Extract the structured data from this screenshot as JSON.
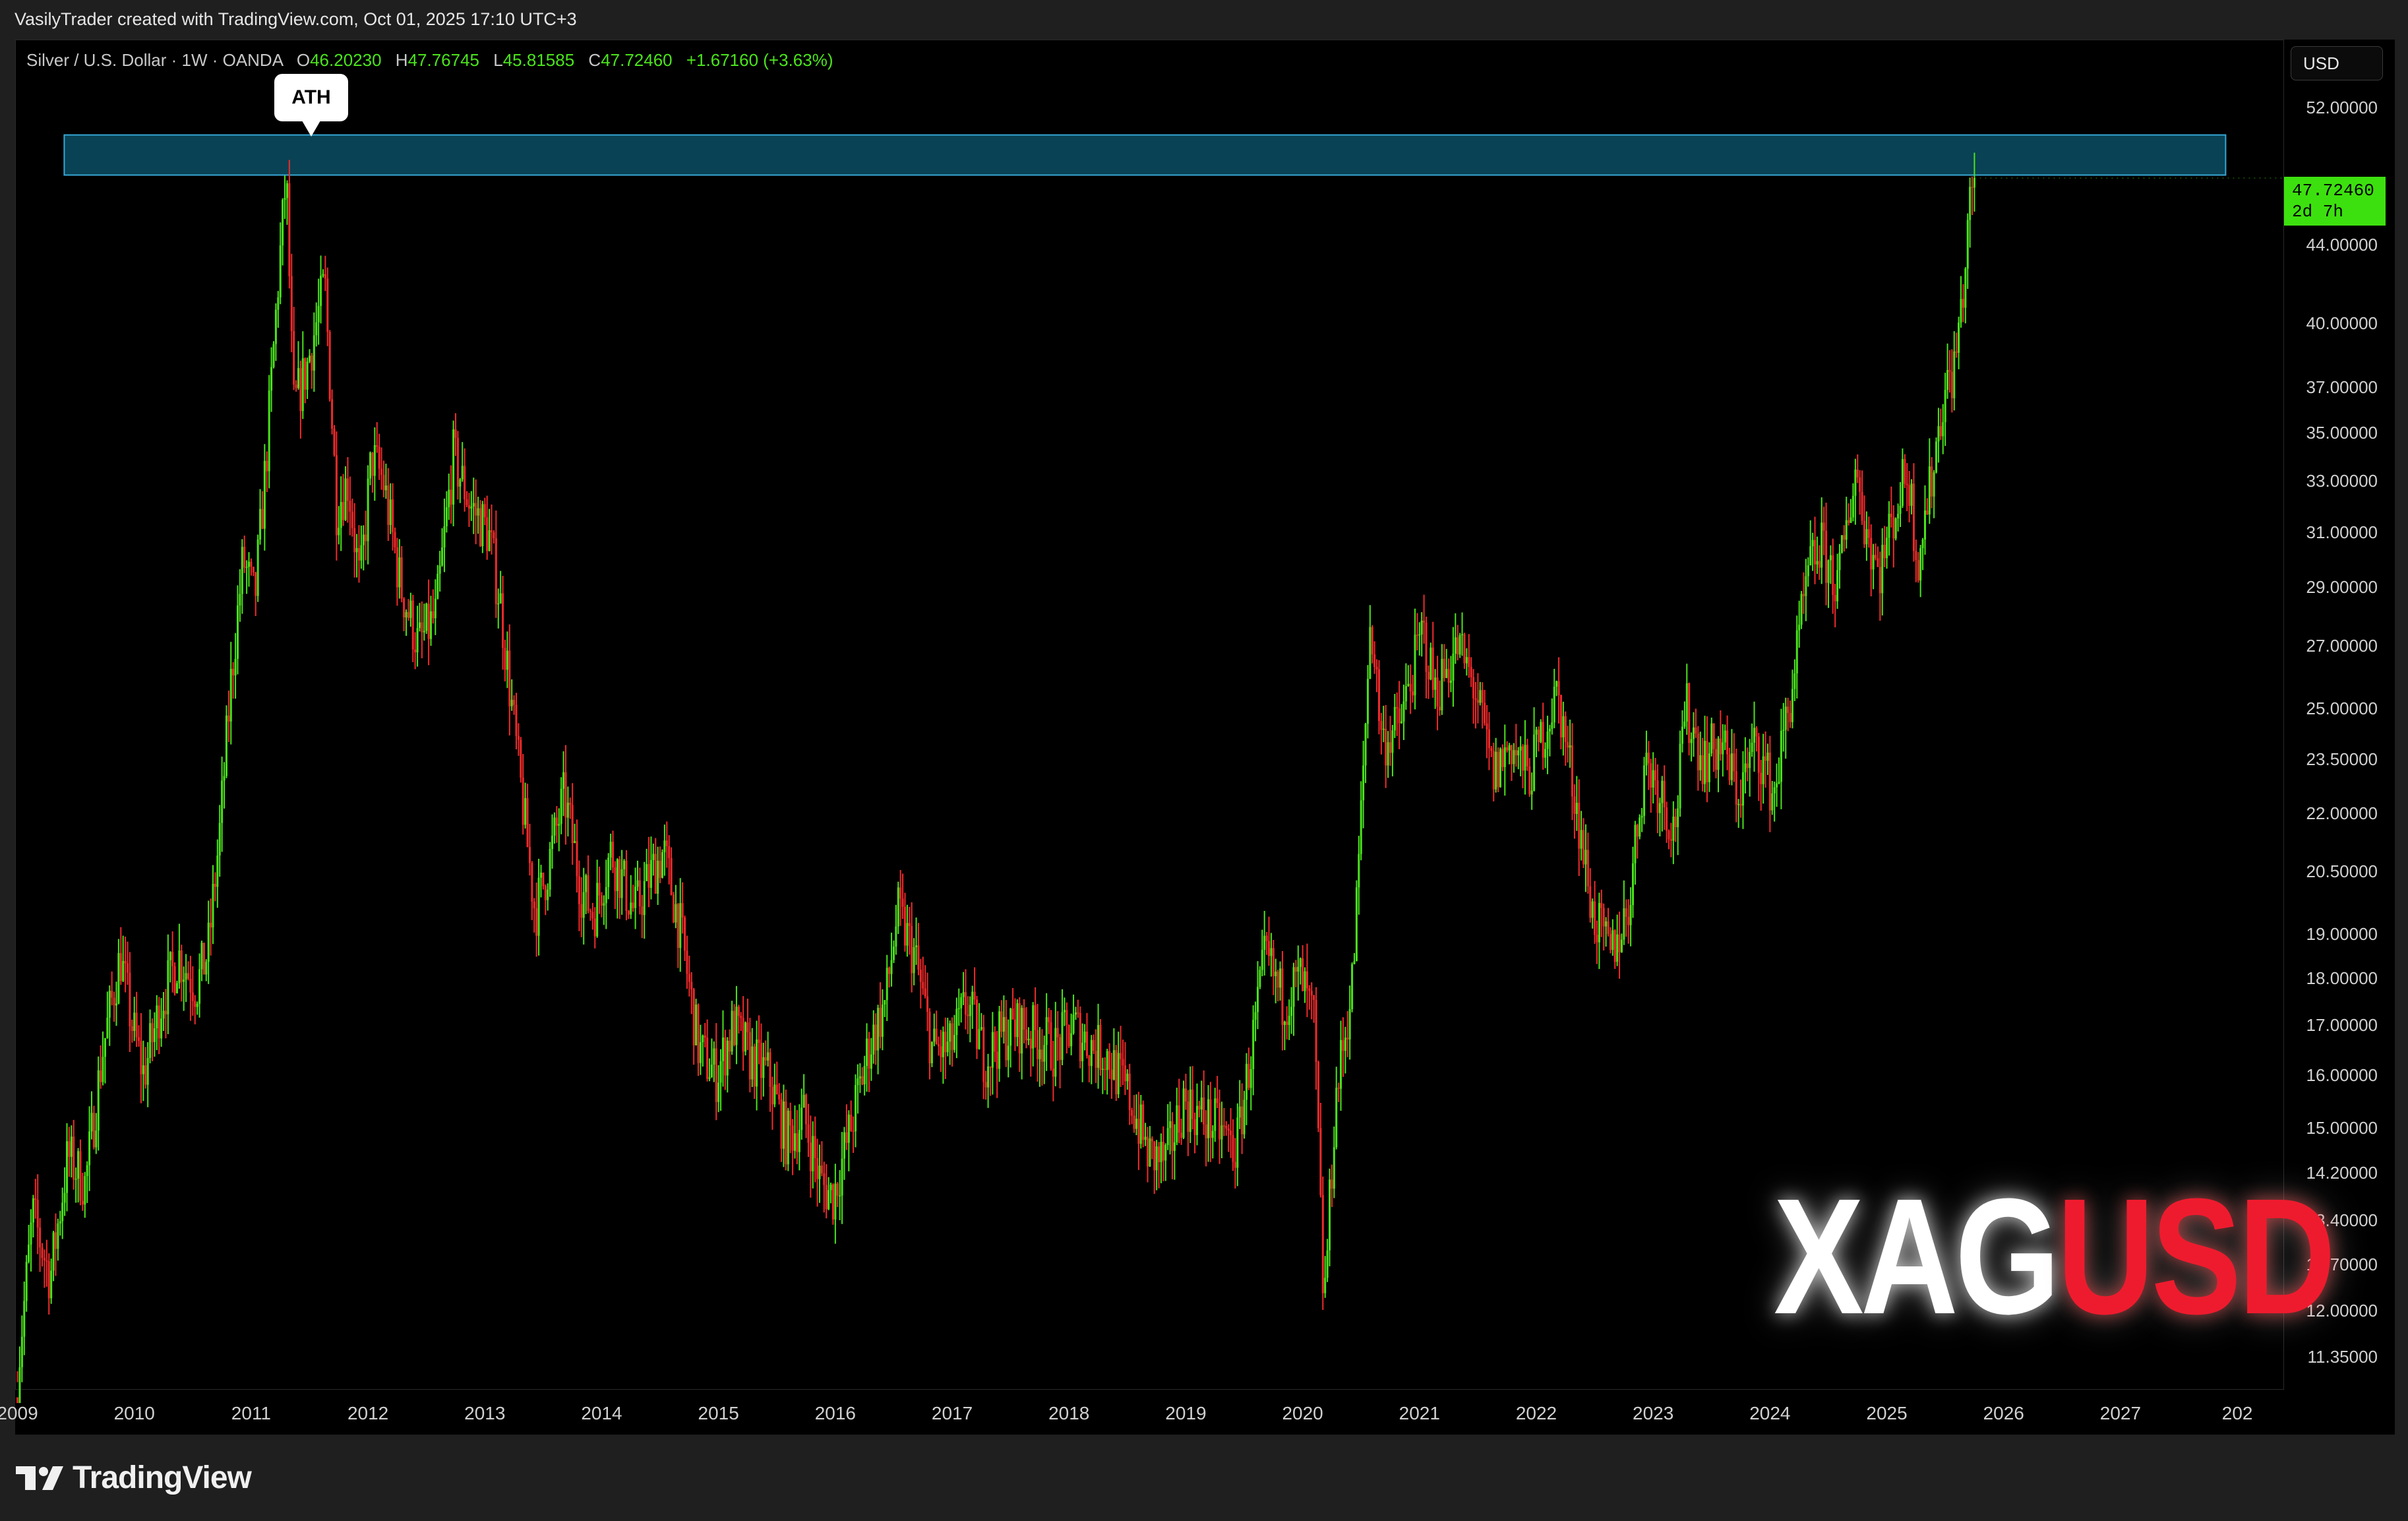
{
  "header": {
    "credit": "VasilyTrader created with TradingView.com, Oct 01, 2025 17:10 UTC+3"
  },
  "legend": {
    "symbol": "Silver / U.S. Dollar · 1W · OANDA",
    "open_label": "O",
    "open": "46.20230",
    "high_label": "H",
    "high": "47.76745",
    "low_label": "L",
    "low": "45.81585",
    "close_label": "C",
    "close": "47.72460",
    "change": "+1.67160 (+3.63%)"
  },
  "currency_button": "USD",
  "price_tag": {
    "price": "47.72460",
    "countdown": "2d 7h"
  },
  "annotation": {
    "label": "ATH"
  },
  "watermark": {
    "part1": "XAG",
    "part2": "USD"
  },
  "footer": {
    "brand": "TradingView"
  },
  "colors": {
    "up": "#4be31c",
    "down": "#ef2b2b",
    "zone_fill": "#0b4e63",
    "zone_border": "#37a8d6",
    "price_tag": "#3de00f"
  },
  "chart_data": {
    "type": "candlestick",
    "symbol": "Silver / U.S. Dollar",
    "interval": "1W",
    "scale": "log",
    "y_ticks": [
      "52.00000",
      "44.00000",
      "40.00000",
      "37.00000",
      "35.00000",
      "33.00000",
      "31.00000",
      "29.00000",
      "27.00000",
      "25.00000",
      "23.50000",
      "22.00000",
      "20.50000",
      "19.00000",
      "18.00000",
      "17.00000",
      "16.00000",
      "15.00000",
      "14.20000",
      "13.40000",
      "12.70000",
      "12.00000",
      "11.35000"
    ],
    "x_ticks": [
      "2009",
      "2010",
      "2011",
      "2012",
      "2013",
      "2014",
      "2015",
      "2016",
      "2017",
      "2018",
      "2019",
      "2020",
      "2021",
      "2022",
      "2023",
      "2024",
      "2025",
      "2026",
      "2027",
      "202"
    ],
    "ylim": [
      10.9,
      56.5
    ],
    "xlim": [
      2008.98,
      2028.4
    ],
    "resistance_zone": {
      "x_start": 2009.4,
      "x_end": 2027.9,
      "y_low": 47.9,
      "y_high": 50.3
    },
    "price_path": [
      [
        2009.0,
        10.8
      ],
      [
        2009.15,
        13.5
      ],
      [
        2009.3,
        12.5
      ],
      [
        2009.45,
        14.5
      ],
      [
        2009.6,
        14.0
      ],
      [
        2009.75,
        16.5
      ],
      [
        2009.9,
        18.5
      ],
      [
        2010.0,
        17.0
      ],
      [
        2010.1,
        16.0
      ],
      [
        2010.25,
        17.5
      ],
      [
        2010.4,
        18.5
      ],
      [
        2010.55,
        17.8
      ],
      [
        2010.65,
        18.6
      ],
      [
        2010.75,
        21.5
      ],
      [
        2010.85,
        26.0
      ],
      [
        2010.95,
        30.0
      ],
      [
        2011.05,
        28.5
      ],
      [
        2011.15,
        34.0
      ],
      [
        2011.25,
        42.0
      ],
      [
        2011.32,
        48.0
      ],
      [
        2011.38,
        36.0
      ],
      [
        2011.5,
        38.0
      ],
      [
        2011.65,
        42.0
      ],
      [
        2011.75,
        32.0
      ],
      [
        2011.85,
        33.0
      ],
      [
        2011.95,
        29.0
      ],
      [
        2012.05,
        34.0
      ],
      [
        2012.15,
        33.0
      ],
      [
        2012.3,
        29.0
      ],
      [
        2012.45,
        27.0
      ],
      [
        2012.6,
        28.0
      ],
      [
        2012.75,
        34.0
      ],
      [
        2012.9,
        32.0
      ],
      [
        2013.05,
        31.0
      ],
      [
        2013.15,
        28.5
      ],
      [
        2013.3,
        23.5
      ],
      [
        2013.45,
        19.5
      ],
      [
        2013.55,
        20.5
      ],
      [
        2013.7,
        22.5
      ],
      [
        2013.85,
        20.0
      ],
      [
        2013.95,
        19.5
      ],
      [
        2014.1,
        21.0
      ],
      [
        2014.3,
        19.5
      ],
      [
        2014.45,
        20.5
      ],
      [
        2014.55,
        21.0
      ],
      [
        2014.7,
        19.0
      ],
      [
        2014.85,
        16.5
      ],
      [
        2015.0,
        16.0
      ],
      [
        2015.15,
        17.0
      ],
      [
        2015.3,
        16.3
      ],
      [
        2015.45,
        16.0
      ],
      [
        2015.6,
        14.8
      ],
      [
        2015.75,
        15.2
      ],
      [
        2015.9,
        14.0
      ],
      [
        2016.0,
        13.8
      ],
      [
        2016.15,
        15.0
      ],
      [
        2016.3,
        16.5
      ],
      [
        2016.45,
        17.5
      ],
      [
        2016.55,
        19.5
      ],
      [
        2016.7,
        18.5
      ],
      [
        2016.85,
        16.5
      ],
      [
        2017.0,
        16.5
      ],
      [
        2017.15,
        17.5
      ],
      [
        2017.3,
        16.3
      ],
      [
        2017.45,
        16.8
      ],
      [
        2017.6,
        17.0
      ],
      [
        2017.75,
        16.8
      ],
      [
        2017.9,
        16.5
      ],
      [
        2018.05,
        17.0
      ],
      [
        2018.2,
        16.6
      ],
      [
        2018.35,
        16.4
      ],
      [
        2018.55,
        15.5
      ],
      [
        2018.7,
        14.5
      ],
      [
        2018.85,
        14.4
      ],
      [
        2019.0,
        15.5
      ],
      [
        2019.15,
        15.2
      ],
      [
        2019.3,
        15.0
      ],
      [
        2019.45,
        14.6
      ],
      [
        2019.6,
        16.8
      ],
      [
        2019.7,
        18.5
      ],
      [
        2019.85,
        17.5
      ],
      [
        2020.0,
        18.0
      ],
      [
        2020.12,
        17.0
      ],
      [
        2020.2,
        12.0
      ],
      [
        2020.3,
        15.5
      ],
      [
        2020.45,
        18.0
      ],
      [
        2020.55,
        24.0
      ],
      [
        2020.6,
        28.0
      ],
      [
        2020.7,
        24.0
      ],
      [
        2020.85,
        24.5
      ],
      [
        2020.95,
        26.0
      ],
      [
        2021.05,
        27.5
      ],
      [
        2021.15,
        25.5
      ],
      [
        2021.35,
        27.0
      ],
      [
        2021.5,
        25.5
      ],
      [
        2021.65,
        23.0
      ],
      [
        2021.8,
        24.0
      ],
      [
        2021.95,
        23.0
      ],
      [
        2022.1,
        24.5
      ],
      [
        2022.2,
        25.5
      ],
      [
        2022.35,
        22.5
      ],
      [
        2022.5,
        19.5
      ],
      [
        2022.65,
        18.5
      ],
      [
        2022.8,
        19.5
      ],
      [
        2022.95,
        23.5
      ],
      [
        2023.1,
        22.5
      ],
      [
        2023.2,
        21.5
      ],
      [
        2023.3,
        25.0
      ],
      [
        2023.45,
        23.5
      ],
      [
        2023.6,
        24.0
      ],
      [
        2023.75,
        22.5
      ],
      [
        2023.9,
        24.0
      ],
      [
        2024.05,
        22.5
      ],
      [
        2024.2,
        25.5
      ],
      [
        2024.35,
        29.5
      ],
      [
        2024.45,
        30.5
      ],
      [
        2024.6,
        29.0
      ],
      [
        2024.75,
        33.5
      ],
      [
        2024.85,
        31.0
      ],
      [
        2024.95,
        29.5
      ],
      [
        2025.1,
        32.0
      ],
      [
        2025.2,
        33.5
      ],
      [
        2025.28,
        30.0
      ],
      [
        2025.4,
        33.0
      ],
      [
        2025.5,
        36.5
      ],
      [
        2025.6,
        38.0
      ],
      [
        2025.68,
        42.0
      ],
      [
        2025.75,
        47.72
      ]
    ],
    "last_price": 47.7246
  }
}
